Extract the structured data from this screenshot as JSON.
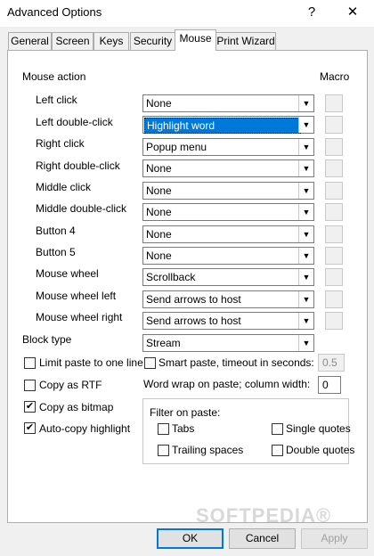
{
  "window": {
    "title": "Advanced Options",
    "help_glyph": "?",
    "close_glyph": "✕"
  },
  "tabs": [
    {
      "label": "General"
    },
    {
      "label": "Screen"
    },
    {
      "label": "Keys"
    },
    {
      "label": "Security"
    },
    {
      "label": "Mouse"
    },
    {
      "label": "Print Wizard"
    }
  ],
  "mouse_action": {
    "header": "Mouse action",
    "macro_header": "Macro",
    "rows": [
      {
        "label": "Left click",
        "value": "None"
      },
      {
        "label": "Left double-click",
        "value": "Highlight word"
      },
      {
        "label": "Right click",
        "value": "Popup menu"
      },
      {
        "label": "Right double-click",
        "value": "None"
      },
      {
        "label": "Middle click",
        "value": "None"
      },
      {
        "label": "Middle double-click",
        "value": "None"
      },
      {
        "label": "Button 4",
        "value": "None"
      },
      {
        "label": "Button 5",
        "value": "None"
      },
      {
        "label": "Mouse wheel",
        "value": "Scrollback"
      },
      {
        "label": "Mouse wheel left",
        "value": "Send arrows to host"
      },
      {
        "label": "Mouse wheel right",
        "value": "Send arrows to host"
      }
    ]
  },
  "block_type": {
    "label": "Block type",
    "value": "Stream"
  },
  "options": {
    "limit_paste": {
      "label": "Limit paste to one line",
      "checked": false
    },
    "copy_rtf": {
      "label": "Copy as RTF",
      "checked": false
    },
    "copy_bitmap": {
      "label": "Copy as bitmap",
      "checked": true
    },
    "auto_copy": {
      "label": "Auto-copy highlight",
      "checked": true
    },
    "smart_paste": {
      "label": "Smart paste, timeout in seconds:",
      "checked": false,
      "value": "0.5"
    },
    "word_wrap": {
      "label": "Word wrap on paste; column width:",
      "value": "0"
    }
  },
  "filter": {
    "label": "Filter on paste:",
    "tabs": {
      "label": "Tabs",
      "checked": false
    },
    "trailing_spaces": {
      "label": "Trailing spaces",
      "checked": false
    },
    "single_quotes": {
      "label": "Single quotes",
      "checked": false
    },
    "double_quotes": {
      "label": "Double quotes",
      "checked": false
    }
  },
  "buttons": {
    "ok": "OK",
    "cancel": "Cancel",
    "apply": "Apply"
  },
  "watermark": "SOFTPEDIA®"
}
